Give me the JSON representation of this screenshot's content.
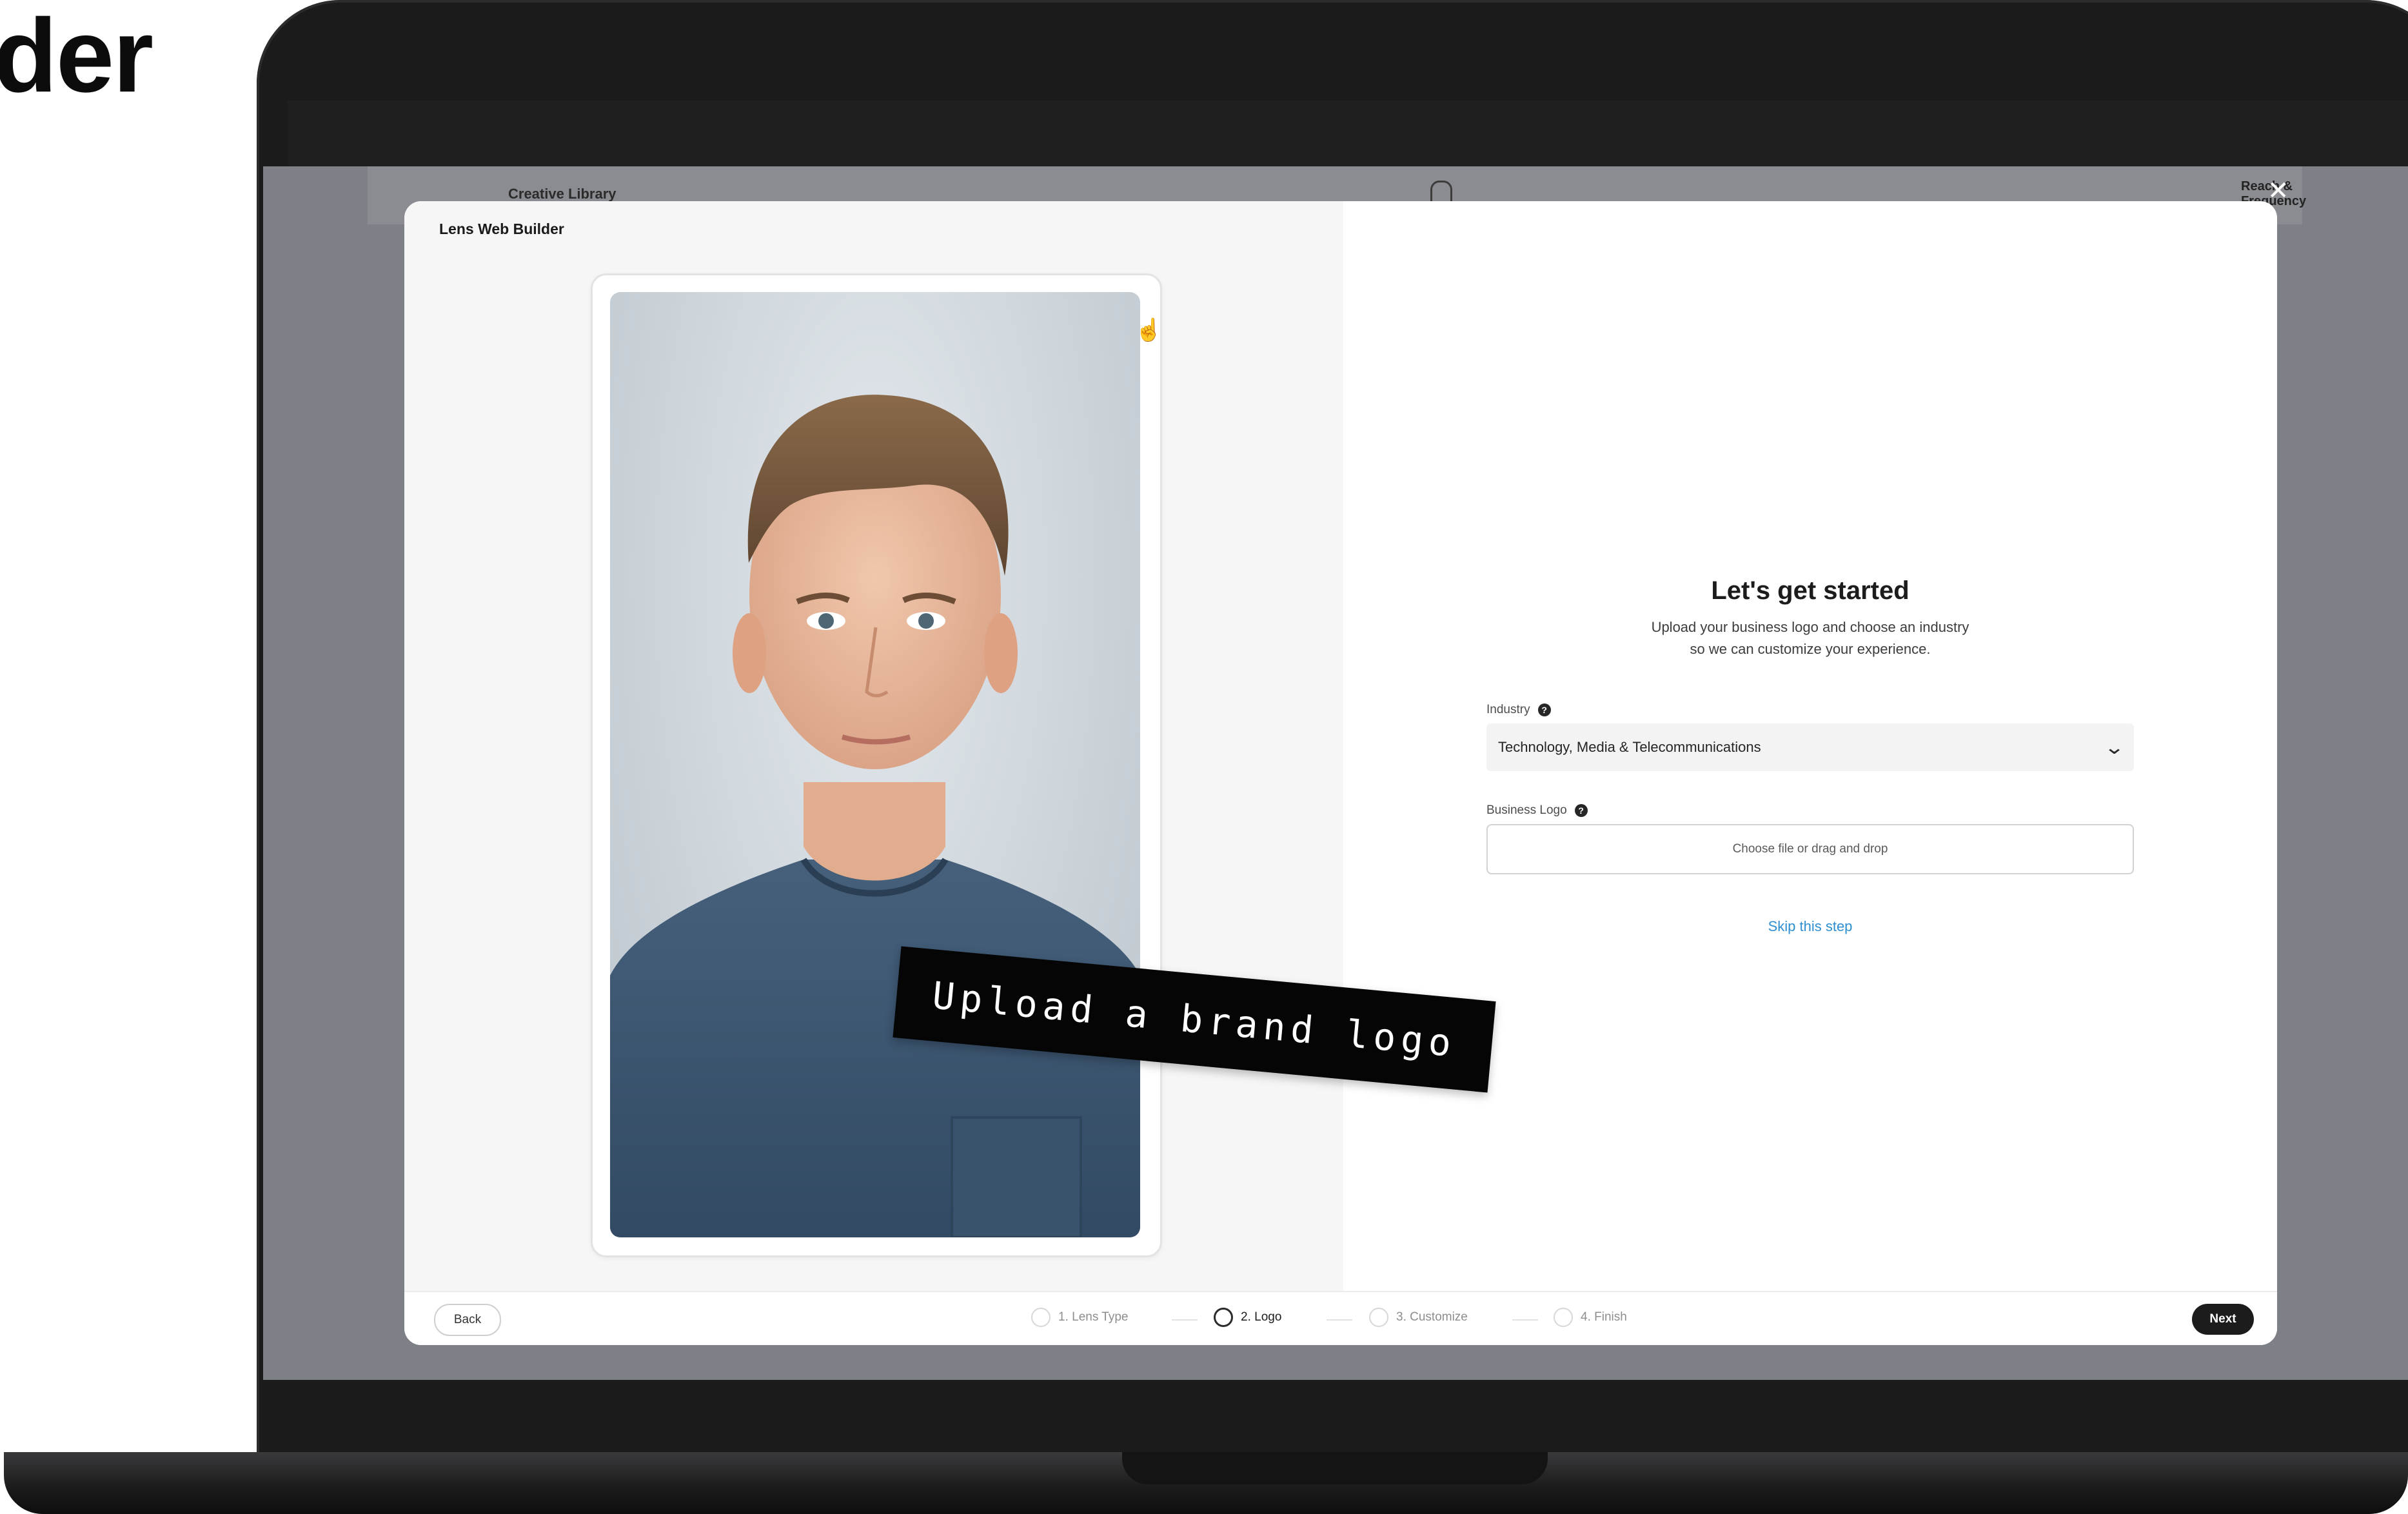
{
  "heading_fragment": "der",
  "background_app": {
    "title": "Creative Library",
    "right_label": "Reach & Frequency",
    "close_glyph": "✕"
  },
  "modal": {
    "title": "Lens Web Builder",
    "heading": "Let's get started",
    "subtitle": "Upload your business logo and choose an industry\nso we can customize your experience.",
    "industry": {
      "label": "Industry",
      "value": "Technology, Media & Telecommunications",
      "help_glyph": "?",
      "chevron": "⌄"
    },
    "business_logo": {
      "label": "Business Logo",
      "help_glyph": "?",
      "placeholder": "Choose file or drag and drop"
    },
    "skip_label": "Skip this step"
  },
  "sticker_text": "Upload a brand logo",
  "footer": {
    "back_label": "Back",
    "next_label": "Next",
    "steps": [
      {
        "label": "1. Lens Type",
        "active": false
      },
      {
        "label": "2. Logo",
        "active": true
      },
      {
        "label": "3. Customize",
        "active": false
      },
      {
        "label": "4. Finish",
        "active": false
      }
    ]
  },
  "colors": {
    "accent_link": "#2f8fd1",
    "next_button": "#1c1c1c",
    "shirt": "#3d5772"
  },
  "icons": {
    "cursor": "hand-pointer-icon",
    "bell": "bell-icon"
  }
}
